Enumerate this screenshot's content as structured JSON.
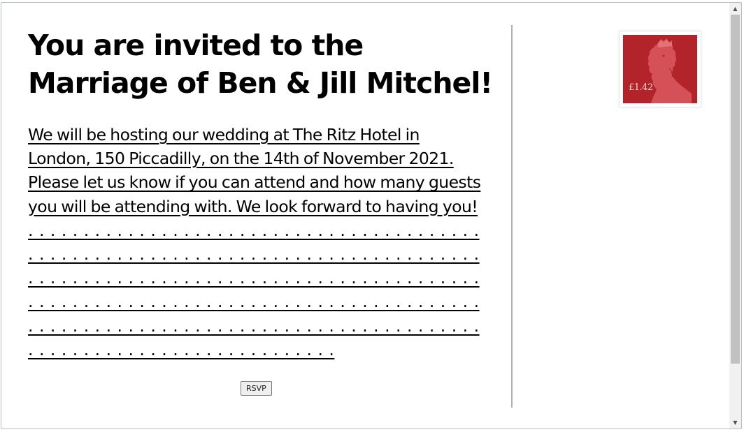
{
  "invitation": {
    "title": "You are invited to the Marriage of Ben & Jill Mitchel!",
    "message": "We will be hosting our wedding at The Ritz Hotel in London, 150 Piccadilly, on the 14th of November 2021. Please let us know if you can attend and how many guests you will be attending with. We look forward to having you!",
    "dots": ". . . . . . . . . . . . . . . . . . . . . . . . . . . . . . . . . . . . . . . . . . . . . . . . . . . . . . . . . . . . . . . . . . . . . . . . . . . . . . . . . . . . . . . . . . . . . . . . . . . . . . . . . . . . . . . . . . . . . . . . . . . . . . . . . . . . . . . . . . . . . . . . . . . . . . . . . . . . . . . . . . . . . . . . . . . . . . . . . . . . . . . . . . . . . . . . . . . . . . . . . . . . . . . . . . . . . . . . . . . . . . . . . . . . . . . . .",
    "rsvp_label": "RSVP"
  },
  "stamp": {
    "value_label": "£1.42",
    "icon": "queen-silhouette-stamp",
    "color": "#b3232a"
  },
  "colors": {
    "divider": "#a6b3c2",
    "text": "#000000"
  }
}
